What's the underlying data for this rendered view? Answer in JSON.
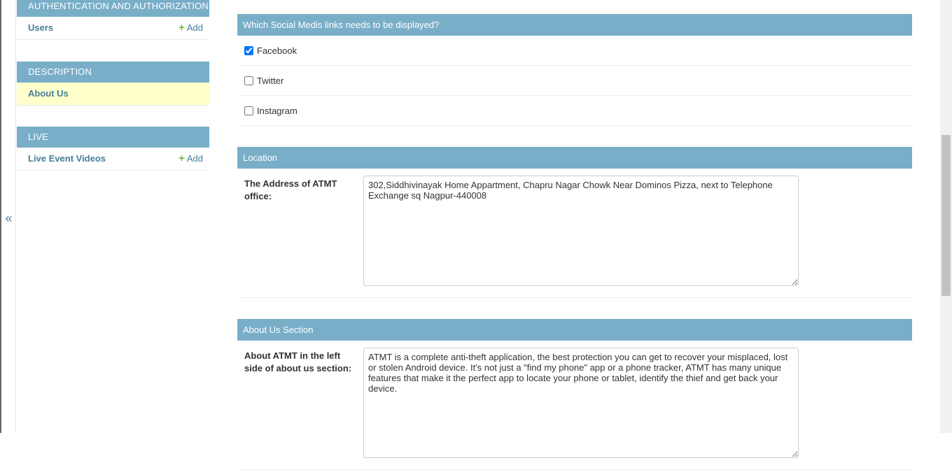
{
  "nav_toggle": {
    "label": "«"
  },
  "sidebar": {
    "modules": [
      {
        "caption": "AUTHENTICATION AND AUTHORIZATION",
        "rows": [
          {
            "label": "Users",
            "add": "Add"
          }
        ]
      },
      {
        "caption": "DESCRIPTION",
        "rows": [
          {
            "label": "About Us",
            "add": ""
          }
        ]
      },
      {
        "caption": "LIVE",
        "rows": [
          {
            "label": "Live Event Videos",
            "add": "Add"
          }
        ]
      }
    ]
  },
  "form": {
    "social": {
      "title": "Which Social Medis links needs to be displayed?",
      "options": [
        {
          "label": "Facebook",
          "checked": true
        },
        {
          "label": "Twitter",
          "checked": false
        },
        {
          "label": "Instagram",
          "checked": false
        }
      ]
    },
    "location": {
      "title": "Location",
      "address_label": "The Address of ATMT office:",
      "address_value": "302,Siddhivinayak Home Appartment, Chapru Nagar Chowk Near Dominos Pizza, next to Telephone Exchange sq Nagpur-440008"
    },
    "about": {
      "title": "About Us Section",
      "left_label": "About ATMT in the left side of about us section:",
      "left_value": "ATMT is a complete anti-theft application, the best protection you can get to recover your misplaced, lost or stolen Android device. It's not just a \"find my phone\" app or a phone tracker, ATMT has many unique features that make it the perfect app to locate your phone or tablet, identify the thief and get back your device."
    }
  }
}
